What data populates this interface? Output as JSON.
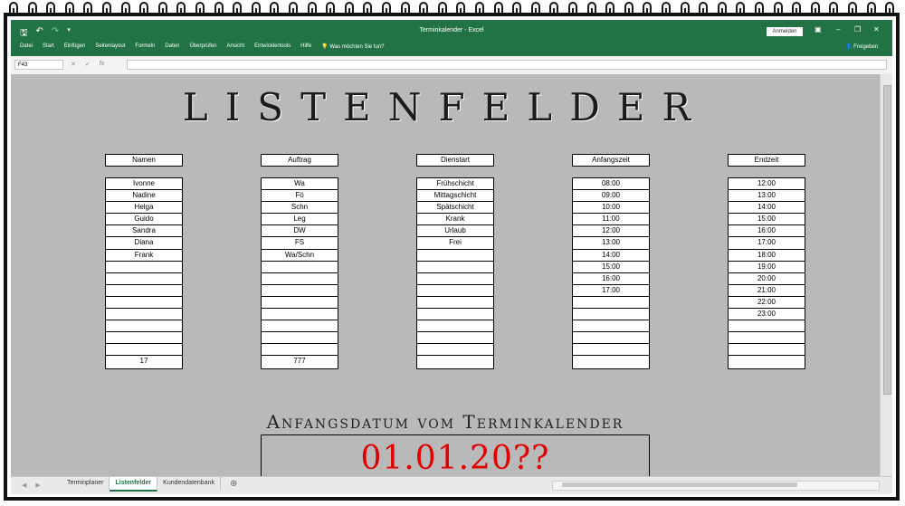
{
  "window": {
    "title": "Terminkalender - Excel",
    "sign_in": "Anmelden",
    "share": "Freigeben"
  },
  "ribbon": {
    "menu": [
      "Datei",
      "Start",
      "Einfügen",
      "Seitenlayout",
      "Formeln",
      "Daten",
      "Überprüfen",
      "Ansicht",
      "Entwicklertools",
      "Hilfe"
    ],
    "tell_me": "Was möchten Sie tun?"
  },
  "formula_bar": {
    "name_box": "F43",
    "fx": "fx",
    "value": ""
  },
  "sheet": {
    "title": "LISTENFELDER",
    "columns": [
      {
        "header": "Namen",
        "items": [
          "Ivonne",
          "Nadine",
          "Helga",
          "Guido",
          "Sandra",
          "Diana",
          "Frank",
          "",
          "",
          "",
          "",
          "",
          "",
          "",
          "",
          "17"
        ]
      },
      {
        "header": "Auftrag",
        "items": [
          "Wa",
          "Fö",
          "Schn",
          "Leg",
          "DW",
          "FS",
          "Wa/Schn",
          "",
          "",
          "",
          "",
          "",
          "",
          "",
          "",
          "777"
        ]
      },
      {
        "header": "Dienstart",
        "items": [
          "Frühschicht",
          "Mittagschicht",
          "Spätschicht",
          "Krank",
          "Urlaub",
          "Frei",
          "",
          "",
          "",
          "",
          "",
          "",
          "",
          "",
          "",
          ""
        ]
      },
      {
        "header": "Anfangszeit",
        "items": [
          "08:00",
          "09:00",
          "10:00",
          "11:00",
          "12:00",
          "13:00",
          "14:00",
          "15:00",
          "16:00",
          "17:00",
          "",
          "",
          "",
          "",
          "",
          ""
        ]
      },
      {
        "header": "Endzeit",
        "items": [
          "12:00",
          "13:00",
          "14:00",
          "15:00",
          "16:00",
          "17:00",
          "18:00",
          "19:00",
          "20:00",
          "21:00",
          "22:00",
          "23:00",
          "",
          "",
          "",
          ""
        ]
      }
    ],
    "start_date_label": "Anfangsdatum vom Terminkalender",
    "start_date_value": "01.01.20??"
  },
  "tabs": [
    {
      "label": "Terminplaner",
      "active": false
    },
    {
      "label": "Listenfelder",
      "active": true
    },
    {
      "label": "Kundendatenbank",
      "active": false
    }
  ],
  "colors": {
    "excel_green": "#217346",
    "date_red": "#e10000",
    "sheet_bg": "#b9b9b9"
  }
}
